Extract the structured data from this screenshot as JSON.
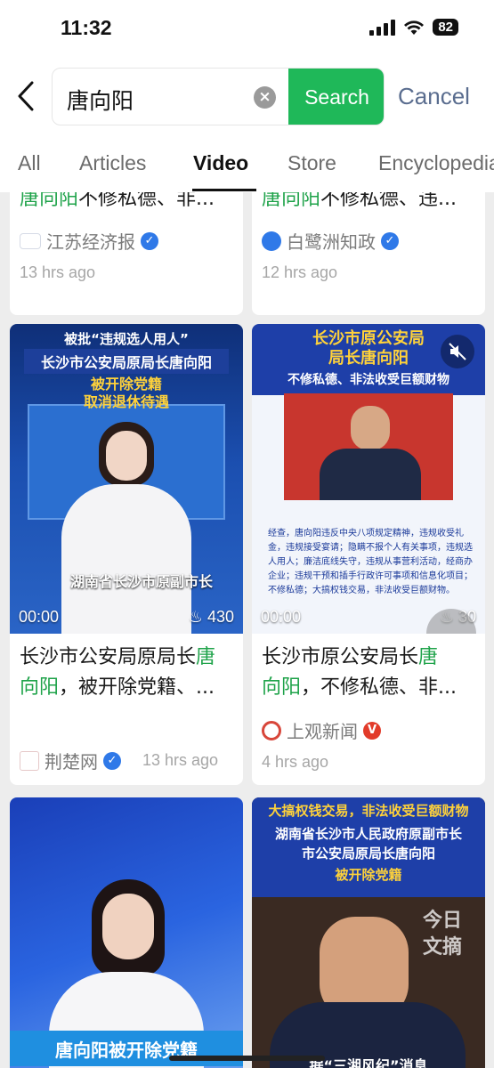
{
  "status": {
    "time": "11:32",
    "battery": "82"
  },
  "search": {
    "query": "唐向阳",
    "button": "Search",
    "cancel": "Cancel"
  },
  "tabs": [
    "All",
    "Articles",
    "Video",
    "Store",
    "Encyclopedia"
  ],
  "cards": [
    {
      "title_hl": "唐向阳",
      "title_rest": "不修私德、非...",
      "source": "江苏经济报",
      "time": "13 hrs ago"
    },
    {
      "title_hl": "唐向阳",
      "title_rest": "不修私德、违...",
      "source": "白鹭洲知政",
      "time": "12 hrs ago"
    },
    {
      "thumb_lines": [
        "被批“违规选人用人”",
        "长沙市公安局原局长唐向阳",
        "被开除党籍",
        "取消退休待遇"
      ],
      "thumb_caption": "湖南省长沙市原副市长",
      "duration": "00:00",
      "likes": "430",
      "title_pre": "长沙市公安局原局长",
      "title_hl1": "唐",
      "title_hl2": "向阳",
      "title_rest": "，被开除党籍、...",
      "source": "荆楚网",
      "time": "13 hrs ago"
    },
    {
      "thumb_lines": [
        "长沙市原公安局",
        "局长唐向阳",
        "不修私德、非法收受巨额财物"
      ],
      "thumb_body": "经查，唐向阳违反中央八项规定精神，违规收受礼金，违规接受宴请；隐瞒不报个人有关事项，违规选人用人；廉洁底线失守，违规从事营利活动，经商办企业；违规干预和插手行政许可事项和信息化项目；不修私德；大搞权钱交易，非法收受巨额财物。",
      "duration": "00:00",
      "likes": "30",
      "title_pre": "长沙市原公安局长",
      "title_hl1": "唐",
      "title_hl2": "向阳",
      "title_rest": "，不修私德、非...",
      "source": "上观新闻",
      "time": "4 hrs ago"
    },
    {
      "thumb_caption": "唐向阳被开除党籍"
    },
    {
      "thumb_lines": [
        "大搞权钱交易，非法收受巨额财物",
        "湖南省长沙市人民政府原副市长",
        "市公安局原局长唐向阳",
        "被开除党籍"
      ],
      "watermark": "今日文摘",
      "thumb_caption": "据“三湘风纪”消息"
    }
  ],
  "colors": {
    "accent": "#1fb859",
    "highlight": "#1fa34a",
    "cancel": "#5a6d8f"
  }
}
